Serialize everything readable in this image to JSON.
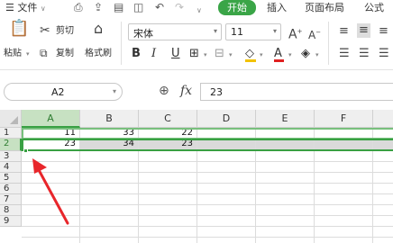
{
  "menu": {
    "file": "文件",
    "tabs": [
      "开始",
      "插入",
      "页面布局",
      "公式"
    ],
    "active_tab": "开始"
  },
  "ribbon": {
    "paste": "粘贴",
    "cut": "剪切",
    "copy": "复制",
    "format_painter": "格式刷",
    "font_name": "宋体",
    "font_size": "11",
    "bold": "B",
    "italic": "I",
    "underline": "U",
    "grow_font": "A",
    "shrink_font": "A"
  },
  "formula_bar": {
    "name_box": "A2",
    "fx": "fx",
    "formula": "23"
  },
  "sheet": {
    "columns": [
      "A",
      "B",
      "C",
      "D",
      "E",
      "F"
    ],
    "selected_column": "A",
    "rows": [
      {
        "num": "1",
        "cells": [
          "11",
          "33",
          "22",
          "",
          "",
          ""
        ]
      },
      {
        "num": "2",
        "cells": [
          "23",
          "34",
          "23",
          "",
          "",
          ""
        ]
      },
      {
        "num": "3",
        "cells": [
          "",
          "",
          "",
          "",
          "",
          ""
        ]
      },
      {
        "num": "4",
        "cells": [
          "",
          "",
          "",
          "",
          "",
          ""
        ]
      },
      {
        "num": "5",
        "cells": [
          "",
          "",
          "",
          "",
          "",
          ""
        ]
      },
      {
        "num": "6",
        "cells": [
          "",
          "",
          "",
          "",
          "",
          ""
        ]
      },
      {
        "num": "7",
        "cells": [
          "",
          "",
          "",
          "",
          "",
          ""
        ]
      },
      {
        "num": "8",
        "cells": [
          "",
          "",
          "",
          "",
          "",
          ""
        ]
      },
      {
        "num": "9",
        "cells": [
          "",
          "",
          "",
          "",
          "",
          ""
        ]
      }
    ],
    "selected_row": "2"
  },
  "colors": {
    "accent": "#3aa547",
    "selection_border": "#39a043",
    "header_selected": "#c7e1c2",
    "annotation_arrow": "#e8262b"
  }
}
